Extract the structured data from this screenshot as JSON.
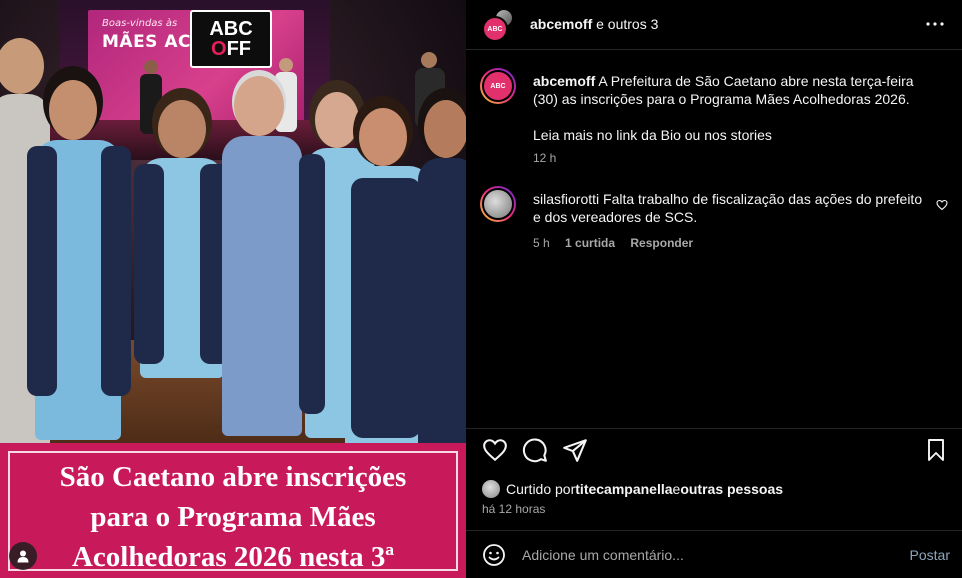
{
  "media": {
    "logo_line1": "ABC",
    "logo_line2a": "O",
    "logo_line2b": "FF",
    "banner_line1": "Boas-vindas às",
    "banner_line2": "MÃES ACOLHE",
    "caption_line1": "São Caetano abre inscrições",
    "caption_line2": "para o Programa Mães",
    "caption_line3": "Acolhedoras 2026 nesta 3ª"
  },
  "header": {
    "username": "abcemoff",
    "suffix": " e outros 3",
    "avatar_text": "ABC"
  },
  "caption_comment": {
    "username": "abcemoff",
    "text": " A Prefeitura de São Caetano abre nesta terça-feira (30) as inscrições para o Programa Mães Acolhedoras 2026.",
    "text2": "Leia mais no link da Bio ou nos stories",
    "time": "12 h",
    "avatar_text": "ABC"
  },
  "comments": [
    {
      "username": "silasfiorotti",
      "text": " Falta trabalho de fiscalização das ações do prefeito e dos vereadores de SCS.",
      "time": "5 h",
      "likes": "1 curtida",
      "reply": "Responder"
    }
  ],
  "likes": {
    "prefix": "Curtido por ",
    "user": "titecampanella",
    "middle": " e ",
    "others": "outras pessoas"
  },
  "posted_time": "há 12 horas",
  "add_comment": {
    "placeholder": "Adicione um comentário...",
    "post_label": "Postar"
  },
  "colors": {
    "accent_pink": "#c8195a",
    "link_blue": "#8fa6bb"
  },
  "icons": [
    "heart-icon",
    "comment-icon",
    "share-icon",
    "bookmark-icon",
    "more-icon",
    "emoji-icon",
    "user-tag-icon"
  ]
}
